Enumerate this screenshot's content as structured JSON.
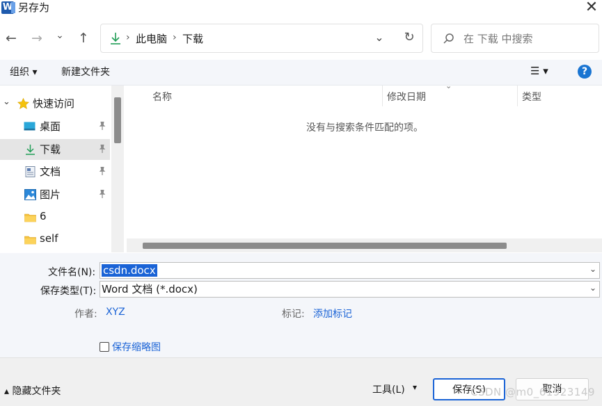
{
  "window": {
    "title": "另存为",
    "close_symbol": "✕"
  },
  "nav": {
    "back": "←",
    "forward": "→",
    "recent": "⌄",
    "up": "↑"
  },
  "address": {
    "path": [
      "此电脑",
      "下载"
    ],
    "separator": "›",
    "dropdown": "⌄",
    "refresh": "↻"
  },
  "search": {
    "placeholder": "在 下载 中搜索"
  },
  "toolbar": {
    "organize": "组织 ▾",
    "new_folder": "新建文件夹",
    "view": "☰ ▾",
    "help": "?"
  },
  "sidebar": {
    "items": [
      {
        "label": "快速访问",
        "icon": "star-icon",
        "pinned": false
      },
      {
        "label": "桌面",
        "icon": "desktop-icon",
        "pinned": true
      },
      {
        "label": "下载",
        "icon": "download-icon",
        "pinned": true,
        "selected": true
      },
      {
        "label": "文档",
        "icon": "document-icon",
        "pinned": true
      },
      {
        "label": "图片",
        "icon": "picture-icon",
        "pinned": true
      },
      {
        "label": "6",
        "icon": "folder-icon",
        "pinned": false
      },
      {
        "label": "self",
        "icon": "folder-icon",
        "pinned": false
      }
    ],
    "expand_symbol": "⌄",
    "pin_symbol": "📌"
  },
  "file_list": {
    "columns": [
      "名称",
      "修改日期",
      "类型"
    ],
    "sort_symbol": "⌄",
    "empty_message": "没有与搜索条件匹配的项。"
  },
  "form": {
    "filename_label": "文件名(N):",
    "filename_value": "csdn.docx",
    "filetype_label": "保存类型(T):",
    "filetype_value": "Word 文档 (*.docx)",
    "dropdown_symbol": "⌄",
    "author_label": "作者:",
    "author_value": "XYZ",
    "tags_label": "标记:",
    "tags_value": "添加标记",
    "thumbnail_label": "保存缩略图"
  },
  "footer": {
    "hide_folders": "▴ 隐藏文件夹",
    "tools": "工具(L)",
    "tools_arrow": "▾",
    "save": "保存(S)",
    "cancel": "取消"
  },
  "watermark": "CSDN @m0_61923149",
  "colors": {
    "accent": "#1a63d6",
    "selection": "#1a63d6",
    "help": "#1a75d2",
    "download_green": "#1f9d55"
  }
}
